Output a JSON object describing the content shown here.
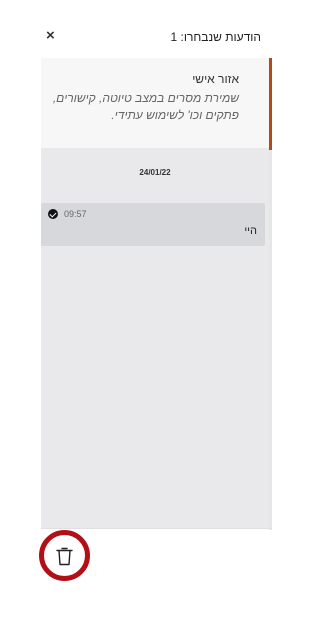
{
  "header": {
    "title": "הודעות שנבחרו: 1",
    "close_symbol": "×"
  },
  "banner": {
    "title": "אזור אישי",
    "description": "שמירת מסרים במצב טיוטה, קישורים, פתקים וכו' לשימוש עתידי."
  },
  "conversation": {
    "date": "24/01/22",
    "messages": [
      {
        "time": "09:57",
        "text": "היי",
        "selected": true,
        "status_icon": "check-circle-icon"
      }
    ]
  },
  "footer": {
    "delete_icon": "trash-icon",
    "highlight_color": "#b30f17"
  }
}
